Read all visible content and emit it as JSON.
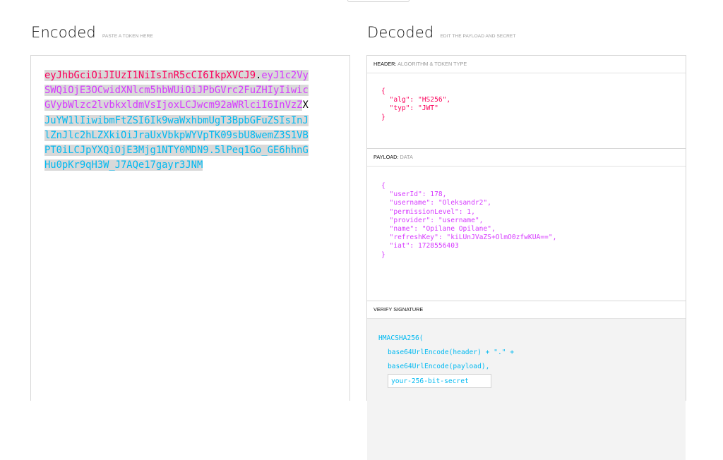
{
  "encoded": {
    "title": "Encoded",
    "hint": "PASTE A TOKEN HERE",
    "token": {
      "header": "eyJhbGciOiJIUzI1NiIsInR5cCI6IkpXVCJ9",
      "dot1": ".",
      "payload": "eyJ1c2VySWQiOjE3OCwidXNlcm5hbWUiOiJPbGVrc2FuZHIyIiwicGVybWlzc2lvbkxldmVsIjoxLCJwcm92aWRlciI6InVzZ",
      "caret_char": "X",
      "signature": "JuYW1lIiwibmFtZSI6Ik9waWxhbmUgT3BpbGFuZSIsInJlZnJlc2hLZXkiOiJraUxVbkpWYVpTK09sbU8wemZ3S1VBPT0iLCJpYXQiOjE3Mjg1NTY0MDN9.5lPeq1Go_GE6hhnGHu0pKr9qH3W_J7AQe17gayr3JNM"
    }
  },
  "decoded": {
    "title": "Decoded",
    "hint": "EDIT THE PAYLOAD AND SECRET",
    "header_section": {
      "label": "HEADER:",
      "sublabel": "ALGORITHM & TOKEN TYPE",
      "json": "{\n  \"alg\": \"HS256\",\n  \"typ\": \"JWT\"\n}"
    },
    "payload_section": {
      "label": "PAYLOAD:",
      "sublabel": "DATA",
      "json": "{\n  \"userId\": 178,\n  \"username\": \"Oleksandr2\",\n  \"permissionLevel\": 1,\n  \"provider\": \"username\",\n  \"name\": \"Opilane Opilane\",\n  \"refreshKey\": \"kiLUnJVaZS+OlmO0zfwKUA==\",\n  \"iat\": 1728556403\n}"
    },
    "verify_section": {
      "label": "VERIFY SIGNATURE",
      "line1": "HMACSHA256(",
      "line2": "base64UrlEncode(header) + \".\" +",
      "line3": "base64UrlEncode(payload),",
      "secret_placeholder": "your-256-bit-secret"
    }
  }
}
